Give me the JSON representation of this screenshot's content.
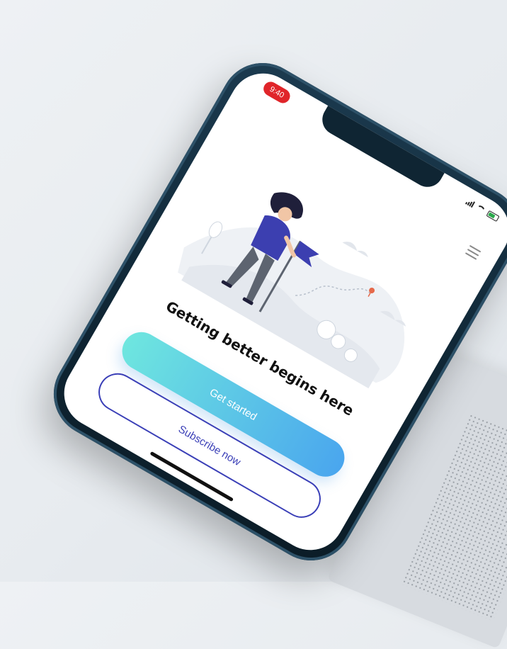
{
  "status_bar": {
    "time": "9:40",
    "icons": [
      "signal-icon",
      "wifi-icon",
      "battery-icon"
    ]
  },
  "header": {
    "menu_icon": "hamburger-menu-icon"
  },
  "illustration": {
    "icon": "hiker-with-flag-illustration"
  },
  "main": {
    "headline": "Getting better begins here"
  },
  "buttons": {
    "primary_label": "Get started",
    "secondary_label": "Subscribe now"
  },
  "colors": {
    "time_pill": "#e0252a",
    "primary_gradient_start": "#6ee6df",
    "primary_gradient_end": "#4aa6ee",
    "secondary_border": "#3a3fb7"
  }
}
